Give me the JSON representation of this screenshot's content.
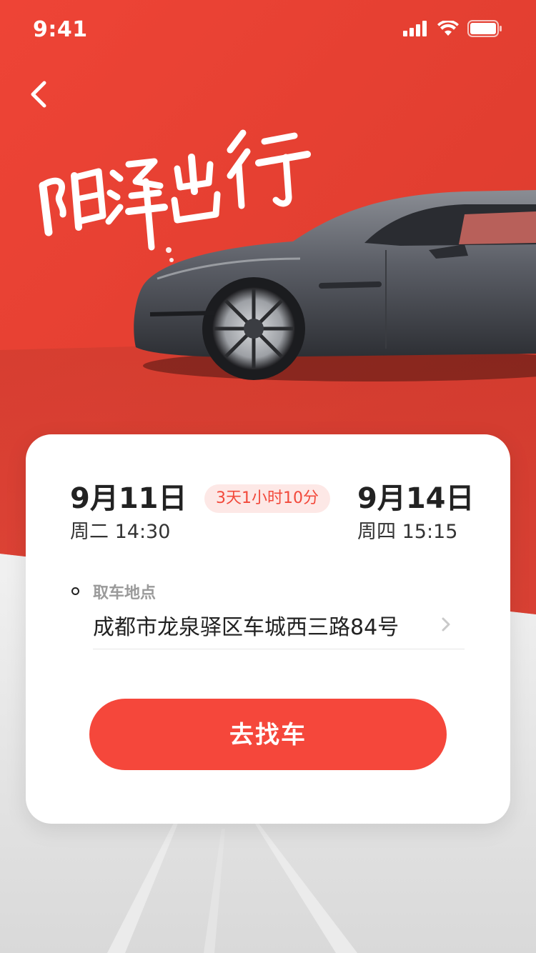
{
  "status_bar": {
    "time": "9:41"
  },
  "icons": {
    "back": "chevron-left-icon",
    "signal": "signal-icon",
    "wifi": "wifi-icon",
    "battery": "battery-icon",
    "chevron": "chevron-right-icon"
  },
  "hero": {
    "calligraphy_text": "阳泽出行"
  },
  "booking": {
    "start": {
      "date": "9月11日",
      "time": "周二 14:30"
    },
    "duration": "3天1小时10分",
    "end": {
      "date": "9月14日",
      "time": "周四 15:15"
    },
    "pickup_label": "取车地点",
    "pickup_address": "成都市龙泉驿区车城西三路84号",
    "button_label": "去找车"
  },
  "colors": {
    "accent": "#f5473b",
    "badge_bg": "#fde8e6",
    "badge_text": "#f2493b"
  }
}
